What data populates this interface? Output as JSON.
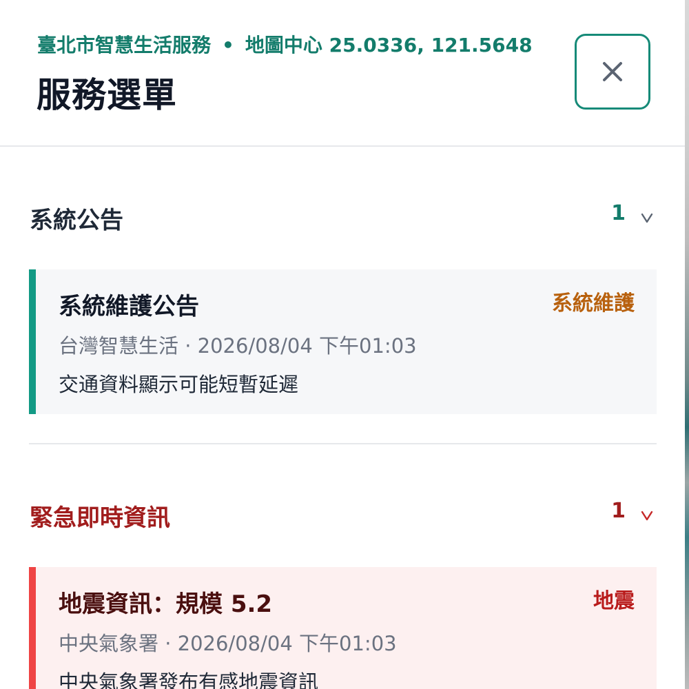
{
  "header": {
    "app_name": "臺北市智慧生活服務",
    "separator": "•",
    "map_center_label": "地圖中心 25.0336, 121.5648",
    "title": "服務選單",
    "close_icon": "close-icon"
  },
  "sections": [
    {
      "title": "系統公告",
      "count": "1",
      "title_color": "#1f2937",
      "count_color": "#137c6b",
      "card": {
        "title": "系統維護公告",
        "tag": "系統維護",
        "meta": "台灣智慧生活 · 2026/08/04 下午01:03",
        "body": "交通資料顯示可能短暫延遲",
        "bar_color": "#139a85",
        "background": "#f6f7f9",
        "tag_color": "#b8610e"
      }
    },
    {
      "title": "緊急即時資訊",
      "count": "1",
      "title_color": "#a11d1d",
      "count_color": "#a11d1d",
      "card": {
        "title": "地震資訊：規模 5.2",
        "tag": "地震",
        "meta": "中央氣象署 · 2026/08/04 下午01:03",
        "body": "中央氣象署發布有感地震資訊",
        "bar_color": "#ef4444",
        "background": "#fdf0f0",
        "tag_color": "#b91c1c"
      }
    }
  ]
}
